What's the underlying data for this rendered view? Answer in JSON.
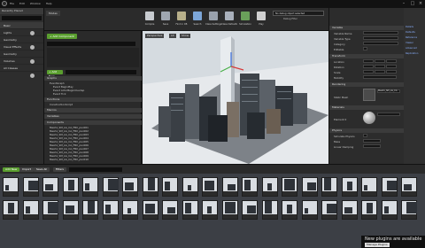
{
  "titlebar": {
    "menu": [
      "File",
      "Edit",
      "Window",
      "Help"
    ],
    "tab_label": "Compiling"
  },
  "left_panel": {
    "header": "Recently Placed",
    "categories": [
      "Basic",
      "Lights",
      "Geometry",
      "Visual Effects",
      "Geometry",
      "Volumes",
      "All Classes"
    ]
  },
  "toolbar": {
    "tab_title": "Modes",
    "tools": [
      {
        "label": "Compile",
        "color": "#c8cbd0"
      },
      {
        "label": "Save",
        "color": "#9fa6b0"
      },
      {
        "label": "Find in CB",
        "color": "#b8b08a"
      },
      {
        "label": "Search",
        "color": "#7ca6d8"
      },
      {
        "label": "Class Settings",
        "color": "#9aa2ad"
      },
      {
        "label": "Class Defaults",
        "color": "#a9b0bb"
      },
      {
        "label": "Simulation",
        "color": "#6aa05a"
      },
      {
        "label": "Play",
        "color": "#d0d0d0"
      }
    ],
    "debug_label": "No debug object selected",
    "debug_filter": "Debug Filter"
  },
  "bp_panel": {
    "add_component": "+ Add Component",
    "search_placeholder": "Search",
    "add_new": "+ Add New",
    "sections": [
      "Graphs",
      "Functions",
      "Macros",
      "Variables",
      "Components"
    ],
    "graphs": [
      "EventGraph",
      "Event BeginPlay",
      "Event ActorBeginOverlap",
      "Event Tick"
    ],
    "functions": [
      "ConstructionScript"
    ],
    "components": [
      "Mesh1_SM_LG_CA_FBX_pivot01",
      "Mesh1_SM_LG_CA_FBX_pivot02",
      "Mesh1_SM_LG_CA_FBX_pivot03",
      "Mesh1_SM_LG_CA_FBX_pivot04",
      "Mesh1_SM_LG_CA_FBX_pivot05",
      "Mesh1_SM_LG_CA_FBX_pivot06",
      "Mesh1_SM_LG_CA_FBX_pivot07",
      "Mesh1_SM_LG_CA_FBX_pivot08",
      "Mesh1_SM_LG_CA_FBX_pivot09",
      "Mesh1_SM_LG_CA_FBX_pivot10"
    ]
  },
  "viewport": {
    "mode_label": "Perspective",
    "lit_label": "Lit",
    "show_label": "Show"
  },
  "right_panel": {
    "sections": [
      "Variable",
      "Transform",
      "Rendering",
      "Materials",
      "Physics"
    ],
    "fields": [
      "Variable Name",
      "Variable Type",
      "Category",
      "Editable",
      "Location",
      "Rotation",
      "Scale",
      "Mobility",
      "Static Mesh",
      "Element 0",
      "Simulate Physics",
      "Mass",
      "Linear Damping"
    ],
    "materials_label": "Materials",
    "static_mesh_value": "Mesh1_SM_LG_CA"
  },
  "far_right": {
    "links": [
      "Details",
      "Defaults",
      "Reference",
      "Viewer",
      "Advanced",
      "Replication"
    ]
  },
  "content_browser": {
    "add_new": "Add New",
    "import": "Import",
    "save_all": "Save All",
    "filter": "Filters",
    "asset_count": 42
  },
  "notification": {
    "text": "New plugins are available",
    "button": "Manage Plugins"
  },
  "colors": {
    "accent_green": "#5a9e2f",
    "link_blue": "#8ab0ff",
    "panel_bg": "#2c2c2c"
  }
}
